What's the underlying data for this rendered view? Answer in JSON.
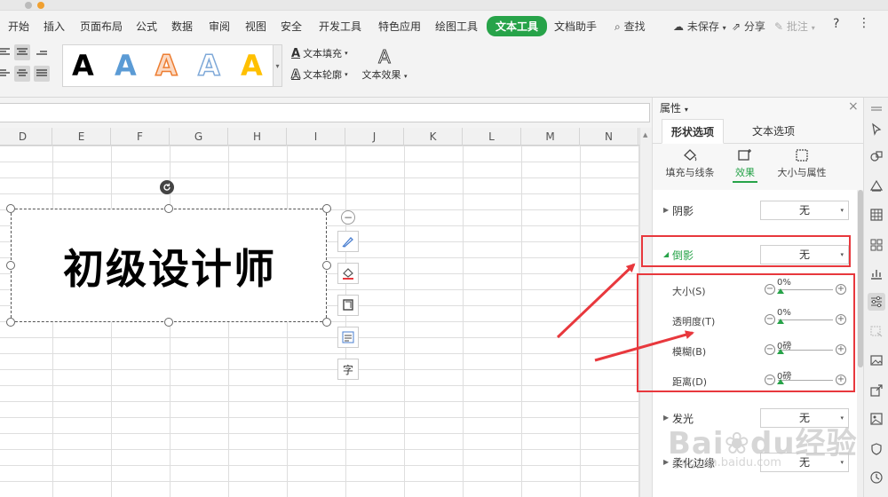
{
  "menu": {
    "items": [
      "开始",
      "插入",
      "页面布局",
      "公式",
      "数据",
      "审阅",
      "视图",
      "安全",
      "开发工具",
      "特色应用",
      "绘图工具",
      "文本工具",
      "文档助手"
    ],
    "active": "文本工具",
    "search": "查找",
    "unsaved": "未保存",
    "share": "分享",
    "comment": "批注",
    "help": "?"
  },
  "ribbon": {
    "style_letter": "A",
    "text_fill": "文本填充",
    "text_outline": "文本轮廓",
    "text_effects": "文本效果",
    "style_colors": [
      "#000000",
      "#5b9bd5",
      "#ed7d31",
      "#a5c8ec",
      "#ffc000"
    ]
  },
  "sheet": {
    "columns": [
      "D",
      "E",
      "F",
      "G",
      "H",
      "I",
      "J",
      "K",
      "L",
      "M",
      "N"
    ],
    "textbox_text": "初级设计师"
  },
  "panel": {
    "title": "属性",
    "tabs": [
      "形状选项",
      "文本选项"
    ],
    "active_tab": "形状选项",
    "subtabs": [
      "填充与线条",
      "效果",
      "大小与属性"
    ],
    "active_subtab": "效果",
    "rows": {
      "shadow": {
        "label": "阴影",
        "value": "无"
      },
      "reflection": {
        "label": "倒影",
        "value": "无"
      },
      "glow": {
        "label": "发光",
        "value": "无"
      },
      "soft_edges": {
        "label": "柔化边缘",
        "value": "无"
      }
    },
    "sliders": [
      {
        "label": "大小(S)",
        "value": "0%"
      },
      {
        "label": "透明度(T)",
        "value": "0%"
      },
      {
        "label": "模糊(B)",
        "value": "0磅"
      },
      {
        "label": "距离(D)",
        "value": "0磅"
      }
    ]
  },
  "watermark": {
    "brand": "Bai",
    "brand2": "du",
    "cn": "经验",
    "url": "jingyan.baidu.com"
  },
  "colors": {
    "accent": "#27a349",
    "annotation": "#e8383d"
  }
}
